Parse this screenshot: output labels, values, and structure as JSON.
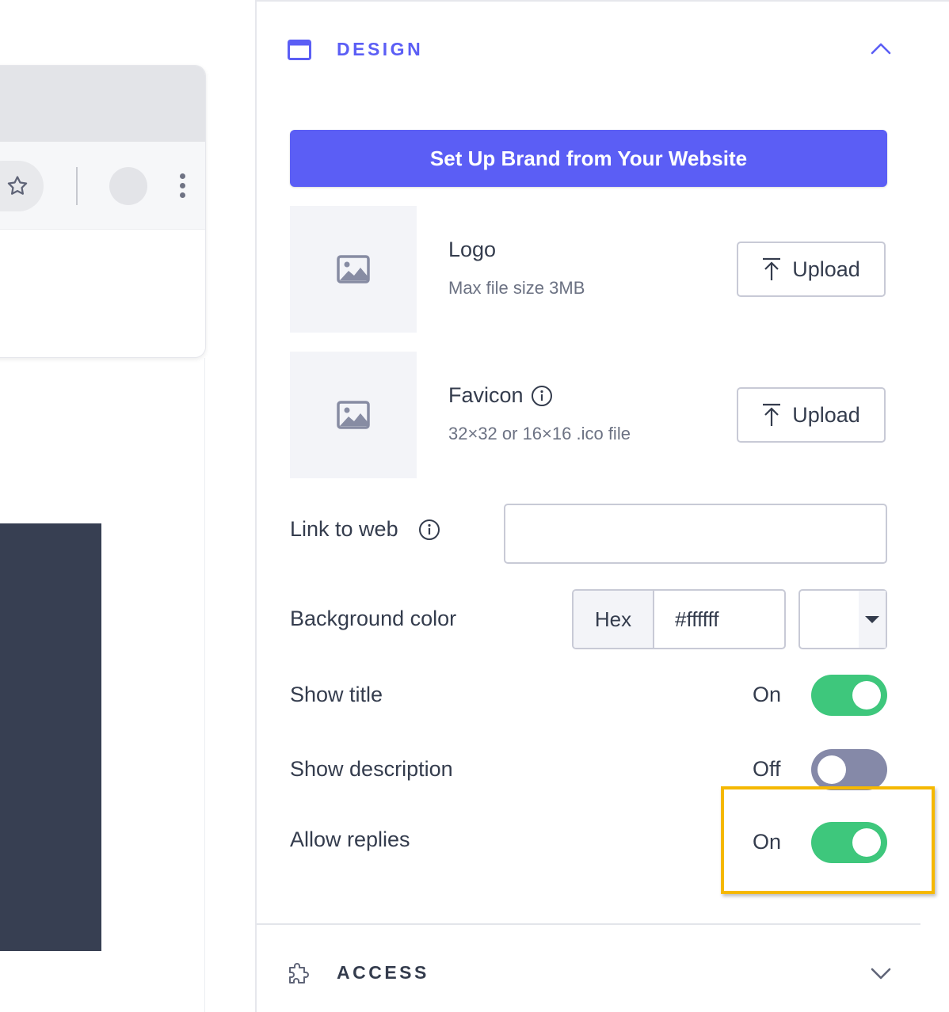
{
  "design_section": {
    "title": "DESIGN",
    "icon": "window-icon",
    "collapse_icon": "chevron-up-icon"
  },
  "brand_button": {
    "label": "Set Up Brand from Your Website"
  },
  "logo": {
    "label": "Logo",
    "hint": "Max file size 3MB",
    "upload_label": "Upload",
    "placeholder_icon": "image-icon"
  },
  "favicon": {
    "label": "Favicon",
    "hint": "32×32 or 16×16 .ico file",
    "upload_label": "Upload",
    "placeholder_icon": "image-icon",
    "info_icon": "info-icon"
  },
  "link_to_web": {
    "label": "Link to web",
    "value": "",
    "info_icon": "info-icon"
  },
  "background_color": {
    "label": "Background color",
    "format_label": "Hex",
    "value": "#ffffff",
    "swatch_color": "#ffffff"
  },
  "toggles": {
    "show_title": {
      "label": "Show title",
      "state": "On",
      "on": true
    },
    "show_description": {
      "label": "Show description",
      "state": "Off",
      "on": false
    },
    "allow_replies": {
      "label": "Allow replies",
      "state": "On",
      "on": true
    }
  },
  "access_section": {
    "title": "ACCESS",
    "icon": "puzzle-icon",
    "expand_icon": "chevron-down-icon"
  },
  "colors": {
    "accent": "#5b5ef5",
    "toggle_on": "#3ec77c",
    "toggle_off": "#8589a8",
    "highlight": "#f5b800",
    "preview_dark": "#373f52"
  }
}
